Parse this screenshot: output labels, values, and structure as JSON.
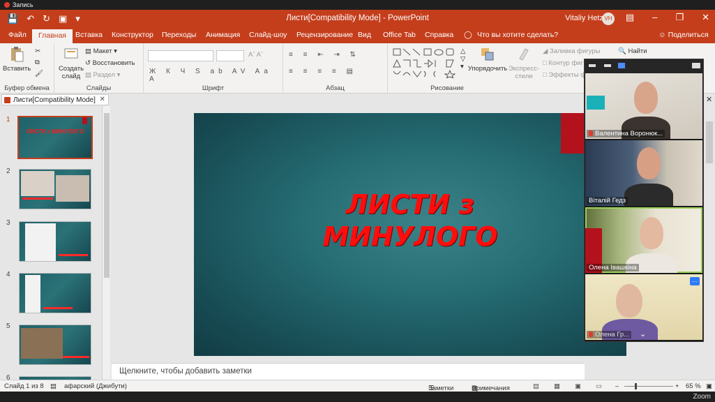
{
  "recording": {
    "label": "Запись"
  },
  "titlebar": {
    "title": "Листи[Compatibility Mode]  -  PowerPoint",
    "user": "Vitaliy Hetz",
    "initials": "VH"
  },
  "tabs": {
    "file": "Файл",
    "home": "Главная",
    "insert": "Вставка",
    "design": "Конструктор",
    "transitions": "Переходы",
    "animation": "Анимация",
    "slideshow": "Слайд-шоу",
    "review": "Рецензирование",
    "view": "Вид",
    "officetab": "Office Tab",
    "help": "Справка",
    "tellme": "Что вы хотите сделать?",
    "share": "Поделиться"
  },
  "ribbon": {
    "paste": "Вставить",
    "clipboard": "Буфер обмена",
    "new_slide": "Создать слайд",
    "layout": "Макет",
    "reset": "Восстановить",
    "section": "Раздел",
    "slides": "Слайды",
    "font": "Шрифт",
    "paragraph": "Абзац",
    "arrange": "Упорядочить",
    "quick_styles": "Экспресс-стили",
    "fill": "Заливка фигуры",
    "outline": "Контур фиг",
    "effects": "Эффекты ф",
    "drawing": "Рисование",
    "find": "Найти"
  },
  "doc_tab": {
    "label": "Листи[Compatibility Mode]"
  },
  "slides": [
    {
      "num": "1",
      "title": "ЛИСТИ з МИНУЛОГО"
    },
    {
      "num": "2"
    },
    {
      "num": "3"
    },
    {
      "num": "4"
    },
    {
      "num": "5"
    },
    {
      "num": "6"
    }
  ],
  "main_slide": {
    "title_line1": "ЛИСТИ з",
    "title_line2": "МИНУЛОГО"
  },
  "notes": {
    "placeholder": "Щелкните, чтобы добавить заметки"
  },
  "status": {
    "slide": "Слайд 1 из 8",
    "language": "афарский (Джибути)",
    "notes": "Заметки",
    "comments": "Примечания",
    "zoom": "65 %"
  },
  "participants": [
    {
      "name": "Валентина Воронюк..."
    },
    {
      "name": "Віталій Гедз"
    },
    {
      "name": "Олена Івашкіна"
    },
    {
      "name": "Олена Гр..."
    }
  ],
  "zoom_label": "Zoom"
}
